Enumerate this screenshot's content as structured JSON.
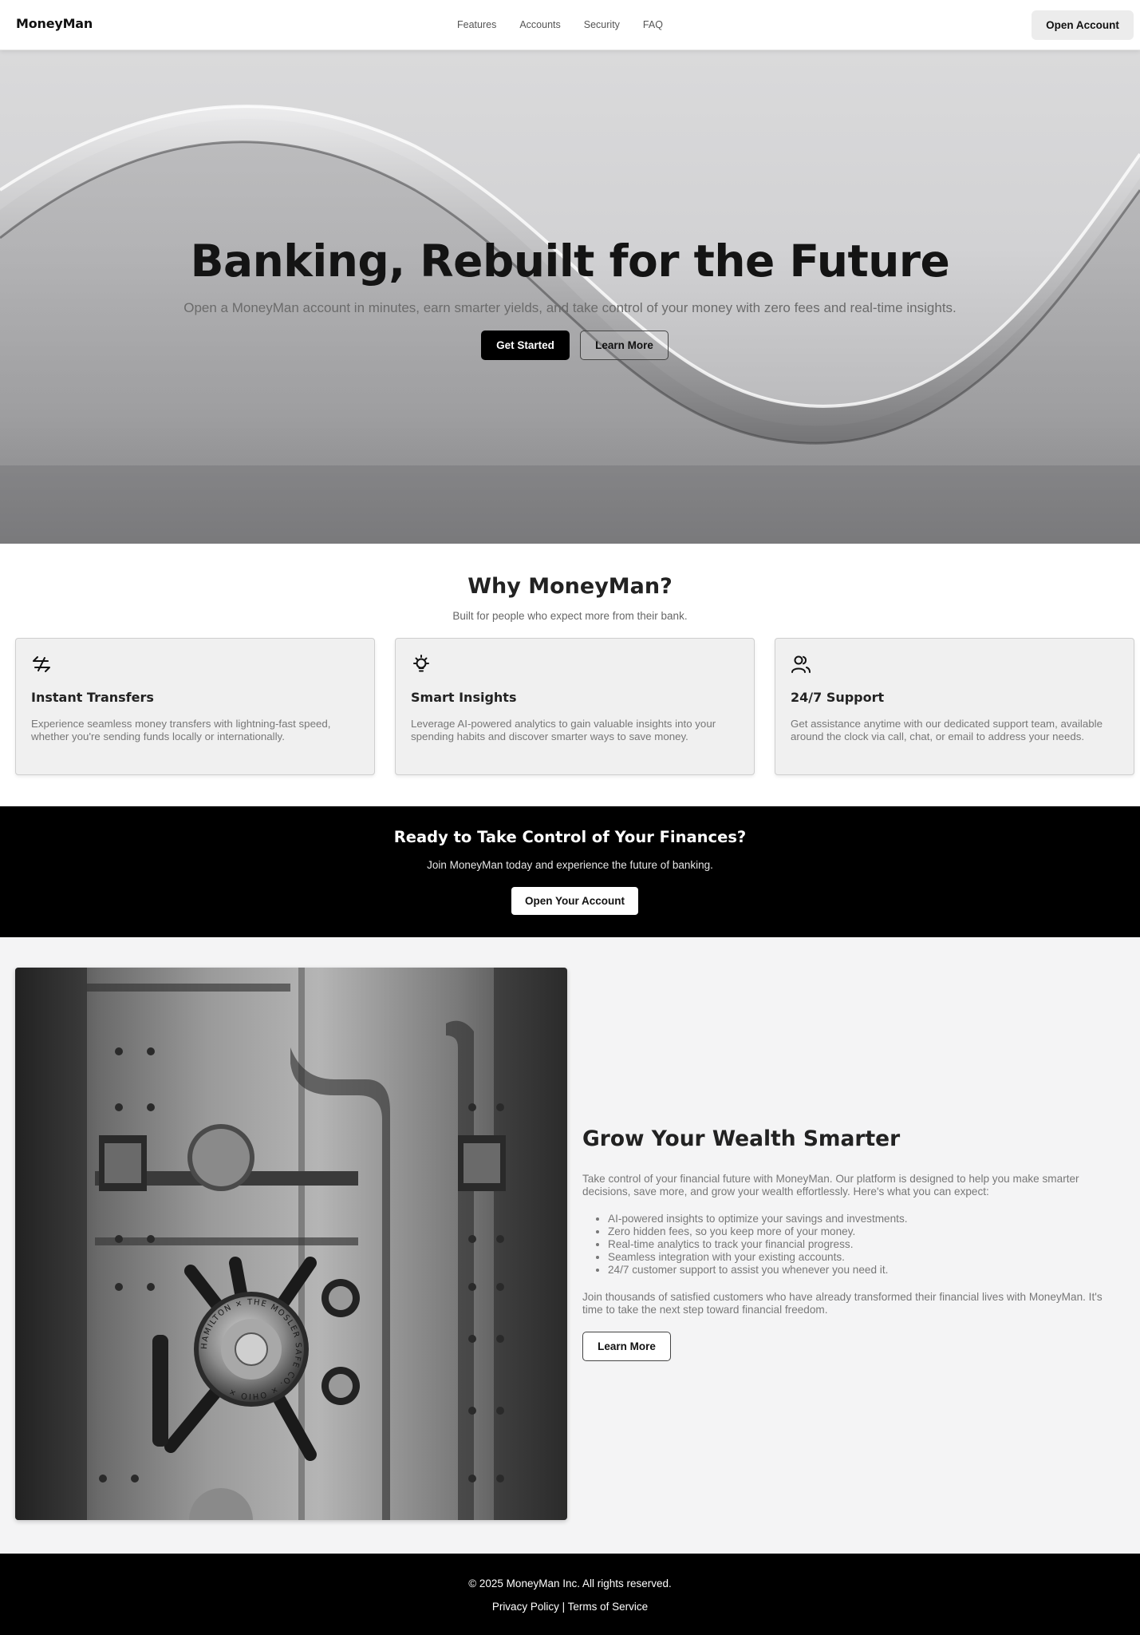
{
  "nav": {
    "brand": "MoneyMan",
    "links": [
      "Features",
      "Accounts",
      "Security",
      "FAQ"
    ],
    "cta": "Open Account"
  },
  "hero": {
    "title": "Banking, Rebuilt for the Future",
    "subtitle": "Open a MoneyMan account in minutes, earn smarter yields, and take control of your money with zero fees and real-time insights.",
    "primary_button": "Get Started",
    "secondary_button": "Learn More"
  },
  "why": {
    "title": "Why MoneyMan?",
    "subtitle": "Built for people who expect more from their bank.",
    "cards": [
      {
        "icon": "transfer-arrows-icon",
        "title": "Instant Transfers",
        "description": "Experience seamless money transfers with lightning-fast speed, whether you're sending funds locally or internationally."
      },
      {
        "icon": "lightbulb-icon",
        "title": "Smart Insights",
        "description": "Leverage AI-powered analytics to gain valuable insights into your spending habits and discover smarter ways to save money."
      },
      {
        "icon": "users-icon",
        "title": "24/7 Support",
        "description": "Get assistance anytime with our dedicated support team, available around the clock via call, chat, or email to address your needs."
      }
    ]
  },
  "cta": {
    "title": "Ready to Take Control of Your Finances?",
    "subtitle": "Join MoneyMan today and experience the future of banking.",
    "button": "Open Your Account"
  },
  "grow": {
    "title": "Grow Your Wealth Smarter",
    "intro": "Take control of your financial future with MoneyMan. Our platform is designed to help you make smarter decisions, save more, and grow your wealth effortlessly. Here's what you can expect:",
    "bullets": [
      "AI-powered insights to optimize your savings and investments.",
      "Zero hidden fees, so you keep more of your money.",
      "Real-time analytics to track your financial progress.",
      "Seamless integration with your existing accounts.",
      "24/7 customer support to assist you whenever you need it."
    ],
    "outro": "Join thousands of satisfied customers who have already transformed their financial lives with MoneyMan. It's time to take the next step toward financial freedom.",
    "button": "Learn More",
    "image_dial_text": "HAMILTON × THE MOSLER SAFE CO. × OHIO ×"
  },
  "footer": {
    "copyright": "© 2025 MoneyMan Inc. All rights reserved.",
    "privacy": "Privacy Policy",
    "separator": "|",
    "terms": "Terms of Service"
  }
}
